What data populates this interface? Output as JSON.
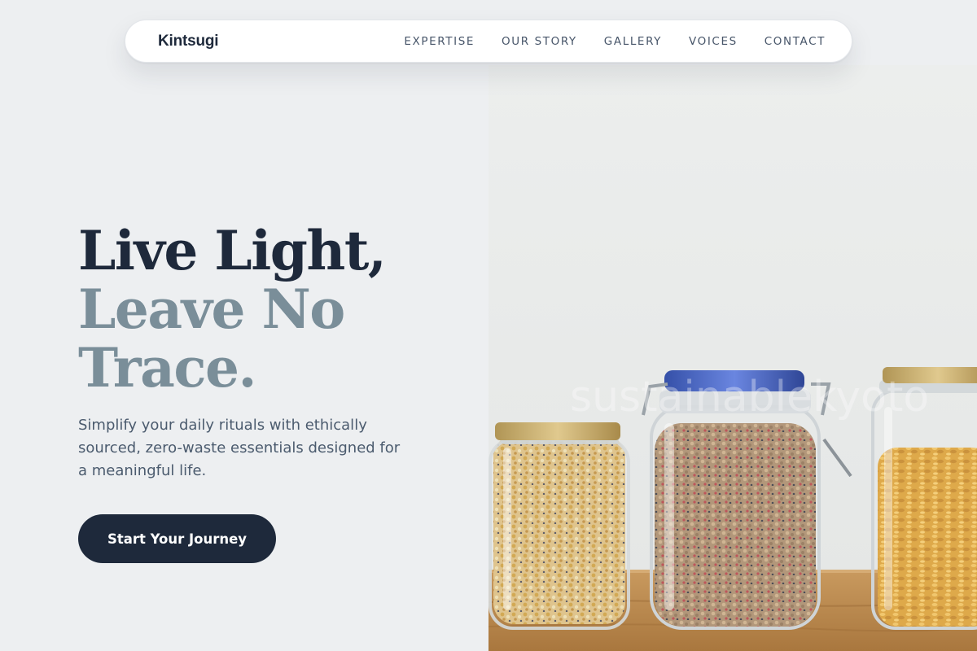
{
  "nav": {
    "brand": "Kintsugi",
    "links": [
      "EXPERTISE",
      "OUR STORY",
      "GALLERY",
      "VOICES",
      "CONTACT"
    ]
  },
  "hero": {
    "headline_line1": "Live Light,",
    "headline_line2": "Leave No",
    "headline_line3": "Trace.",
    "subtext": "Simplify your daily rituals with ethically sourced, zero-waste essentials designed for a meaningful life.",
    "cta_label": "Start Your Journey",
    "image_watermark": "sustainablekyoto"
  },
  "colors": {
    "primary_dark": "#1e293b",
    "accent_muted": "#7a8e99",
    "background": "#edeff1"
  }
}
